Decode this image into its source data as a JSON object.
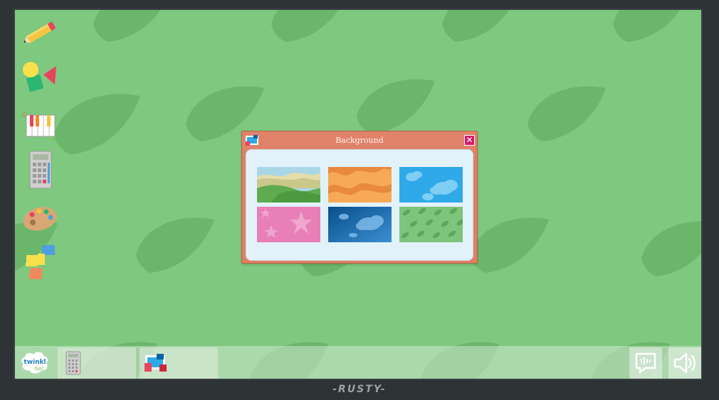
{
  "window": {
    "title": "Background"
  },
  "desktop_icons": [
    {
      "name": "pencil-icon",
      "label": "Draw"
    },
    {
      "name": "shapes-icon",
      "label": "Shapes"
    },
    {
      "name": "piano-icon",
      "label": "Piano"
    },
    {
      "name": "calculator-icon",
      "label": "Calculator"
    },
    {
      "name": "palette-icon",
      "label": "Paint"
    },
    {
      "name": "jigsaw-icon",
      "label": "Jigsaw"
    }
  ],
  "backgrounds": [
    {
      "name": "hills",
      "colors": [
        "#8fc7dc",
        "#5fab4f"
      ]
    },
    {
      "name": "orange-waves",
      "colors": [
        "#f7a955",
        "#e8893c"
      ]
    },
    {
      "name": "blue-clouds",
      "colors": [
        "#2fa9e8",
        "#7fcff4"
      ]
    },
    {
      "name": "pink-stars",
      "colors": [
        "#e87fb6",
        "#f0a6cd"
      ]
    },
    {
      "name": "night-clouds",
      "colors": [
        "#0c63a6",
        "#4b97d1"
      ]
    },
    {
      "name": "green-leaves",
      "colors": [
        "#62b35e",
        "#8ed08a"
      ]
    }
  ],
  "taskbar": {
    "logo_top": "twinkl",
    "logo_bottom": "Go!",
    "tasks": [
      {
        "name": "calculator-task",
        "icon": "calculator-icon"
      },
      {
        "name": "background-task",
        "icon": "background-icon"
      }
    ],
    "buttons": [
      {
        "name": "speech-button",
        "icon": "speech-bubble-icon"
      },
      {
        "name": "volume-button",
        "icon": "speaker-icon"
      }
    ]
  },
  "brand": "-RUSTY-",
  "colors": {
    "desktop_bg": "#7ec87f",
    "leaf": "#68b569",
    "titlebar": "#e0826a",
    "close": "#d61b6b",
    "panel": "#e2f2fb",
    "accent": "#39c3c9"
  }
}
